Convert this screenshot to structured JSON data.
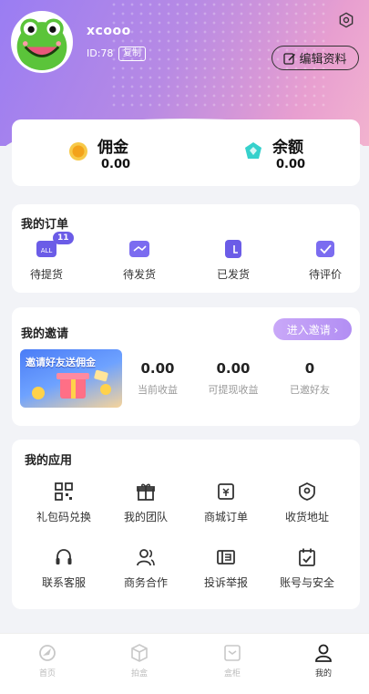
{
  "profile": {
    "username": "xcooo",
    "id_text": "ID:78",
    "copy_label": "复制",
    "edit_label": "编辑资料"
  },
  "balance": [
    {
      "label": "佣金",
      "value": "0.00",
      "icon": "coin-icon",
      "color": "#f7b52c"
    },
    {
      "label": "余额",
      "value": "0.00",
      "icon": "diamond-icon",
      "color": "#2ec9c4"
    }
  ],
  "orders": {
    "title": "我的订单",
    "items": [
      {
        "label": "待提货",
        "badge": "11",
        "icon": "pickup-icon"
      },
      {
        "label": "待发货",
        "icon": "to-ship-icon"
      },
      {
        "label": "已发货",
        "icon": "shipped-icon"
      },
      {
        "label": "待评价",
        "icon": "review-icon"
      }
    ]
  },
  "invite": {
    "title": "我的邀请",
    "button_label": "进入邀请 ›",
    "banner_text": "邀请好友送佣金",
    "stats": [
      {
        "value": "0.00",
        "label": "当前收益"
      },
      {
        "value": "0.00",
        "label": "可提现收益"
      },
      {
        "value": "0",
        "label": "已邀好友"
      }
    ]
  },
  "apps": {
    "title": "我的应用",
    "items": [
      {
        "label": "礼包码兑换",
        "icon": "qrcode-icon"
      },
      {
        "label": "我的团队",
        "icon": "gift-icon"
      },
      {
        "label": "商城订单",
        "icon": "order-ticket-icon"
      },
      {
        "label": "收货地址",
        "icon": "location-icon"
      },
      {
        "label": "联系客服",
        "icon": "headset-icon"
      },
      {
        "label": "商务合作",
        "icon": "users-icon"
      },
      {
        "label": "投诉举报",
        "icon": "report-icon"
      },
      {
        "label": "账号与安全",
        "icon": "calendar-check-icon"
      }
    ]
  },
  "tabs": [
    {
      "label": "首页",
      "icon": "home-icon",
      "active": false
    },
    {
      "label": "拍盒",
      "icon": "box-icon",
      "active": false
    },
    {
      "label": "盒柜",
      "icon": "cabinet-icon",
      "active": false
    },
    {
      "label": "我的",
      "icon": "user-icon",
      "active": true
    }
  ],
  "colors": {
    "accent": "#6b5ce7",
    "invite_button": "#b28ef3"
  }
}
